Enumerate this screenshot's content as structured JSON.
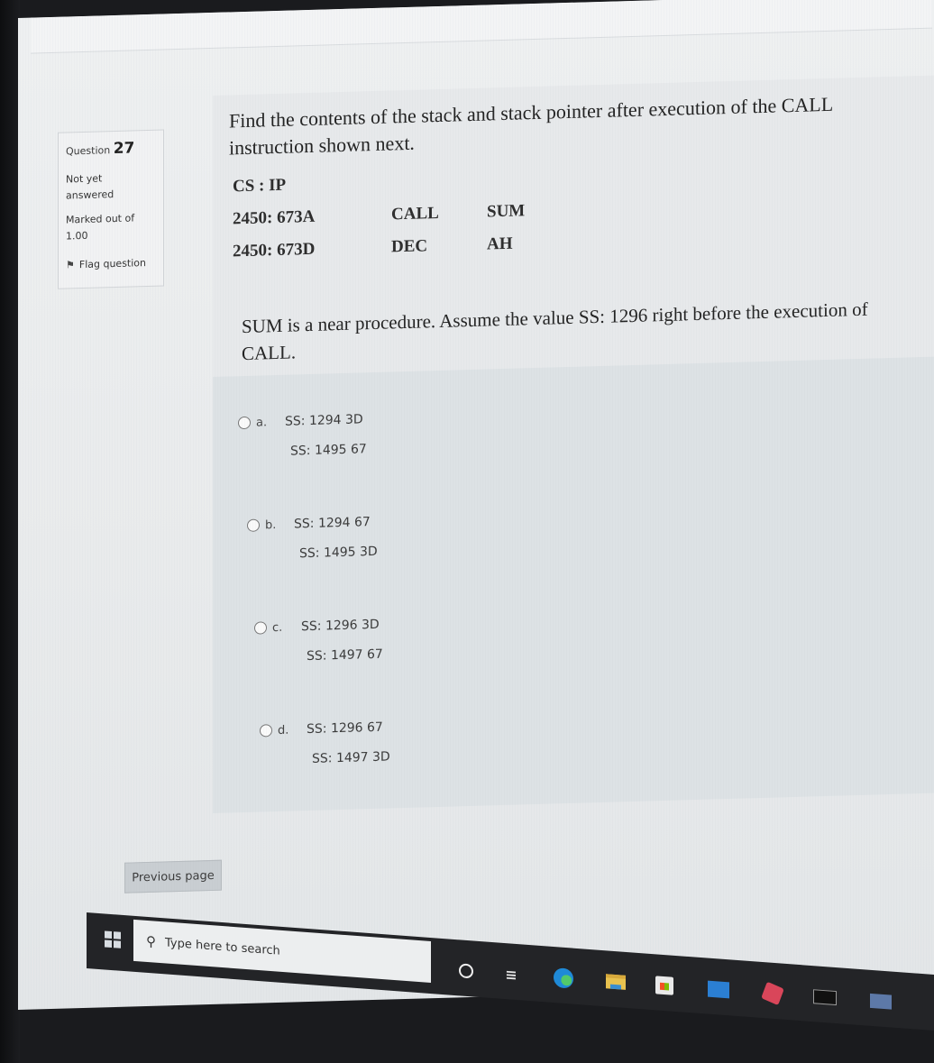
{
  "question_info": {
    "label": "Question",
    "number": "27",
    "state_line1": "Not yet",
    "state_line2": "answered",
    "grade_line1": "Marked out of",
    "grade_line2": "1.00",
    "flag_label": "Flag question"
  },
  "question": {
    "intro": "Find the contents of the stack and stack pointer after execution of the CALL instruction shown next.",
    "code_rows": [
      [
        "CS : IP",
        "",
        ""
      ],
      [
        "2450: 673A",
        "CALL",
        "SUM"
      ],
      [
        "2450: 673D",
        "DEC",
        "AH"
      ]
    ],
    "assumption": "SUM is a near procedure. Assume the value SS: 1296 right before the execution of CALL."
  },
  "options": [
    {
      "letter": "a.",
      "line1": "SS: 1294 3D",
      "line2": "SS: 1495 67"
    },
    {
      "letter": "b.",
      "line1": "SS: 1294 67",
      "line2": "SS: 1495 3D"
    },
    {
      "letter": "c.",
      "line1": "SS: 1296 3D",
      "line2": "SS: 1497 67"
    },
    {
      "letter": "d.",
      "line1": "SS: 1296 67",
      "line2": "SS: 1497 3D"
    }
  ],
  "navigation": {
    "previous_label": "Previous page"
  },
  "taskbar": {
    "search_placeholder": "Type here to search",
    "icons": [
      "cortana-icon",
      "task-view-icon",
      "edge-icon",
      "file-explorer-icon",
      "store-icon",
      "mail-icon",
      "app-icon",
      "terminal-icon",
      "app-window-icon"
    ]
  }
}
